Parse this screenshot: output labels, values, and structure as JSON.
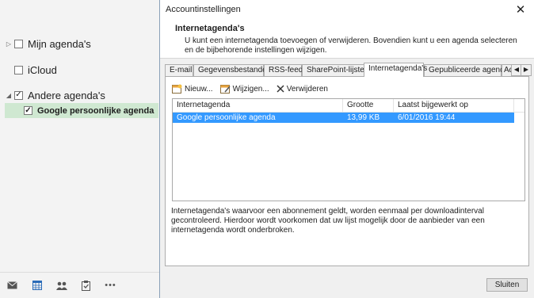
{
  "left_pane": {
    "groups": [
      {
        "label": "Mijn agenda's",
        "expander": "▷",
        "checked": false
      },
      {
        "label": "iCloud",
        "expander": "",
        "checked": false
      },
      {
        "label": "Andere agenda's",
        "expander": "◢",
        "checked": true
      }
    ],
    "calendar_item": {
      "label": "Google persoonlijke agenda",
      "checked": true,
      "color": "#cfe8d1"
    },
    "nav_buttons": [
      "mail-icon",
      "calendar-icon",
      "people-icon",
      "tasks-icon",
      "more-icon"
    ],
    "more_label": "•••"
  },
  "dialog": {
    "title": "Accountinstellingen",
    "close_glyph": "✕",
    "header_title": "Internetagenda's",
    "header_desc": "U kunt een internetagenda toevoegen of verwijderen. Bovendien kunt u een agenda selecteren en de bijbehorende instellingen wijzigen.",
    "tabs": [
      "E-mail",
      "Gegevensbestanden",
      "RSS-feeds",
      "SharePoint-lijsten",
      "Internetagenda's",
      "Gepubliceerde agenda's",
      "Ad"
    ],
    "active_tab": "Internetagenda's",
    "toolbar": {
      "new": "Nieuw...",
      "edit": "Wijzigen...",
      "delete": "Verwijderen"
    },
    "list": {
      "columns": [
        "Internetagenda",
        "Grootte",
        "Laatst bijgewerkt op"
      ],
      "rows": [
        {
          "name": "Google persoonlijke agenda",
          "size": "13,99 KB",
          "updated": "6/01/2016 19:44"
        }
      ],
      "selected_color": "#3399ff"
    },
    "info_text": "Internetagenda's waarvoor een abonnement geldt, worden eenmaal per downloadinterval gecontroleerd. Hierdoor wordt voorkomen dat uw lijst mogelijk door de aanbieder van een internetagenda wordt onderbroken.",
    "close_button": "Sluiten"
  }
}
